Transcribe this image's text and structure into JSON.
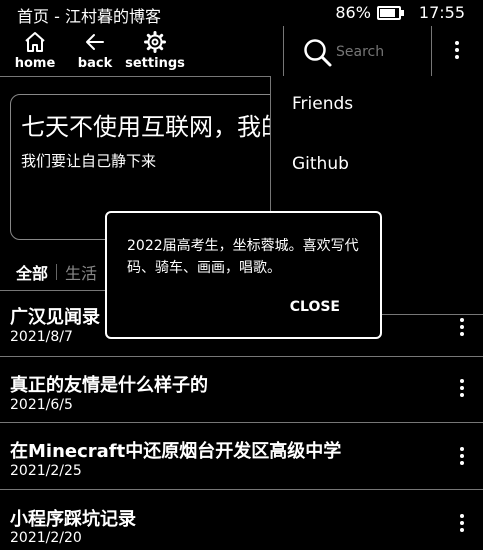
{
  "status_bar": {
    "title": "首页 - 江村暮的博客",
    "battery_percent": "86%",
    "battery_level": 0.86,
    "time": "17:55"
  },
  "toolbar": {
    "home_label": "home",
    "home_icon": "home-icon",
    "back_label": "back",
    "back_icon": "arrow-left-icon",
    "settings_label": "settings",
    "settings_icon": "gear-icon",
    "search_placeholder": "Search"
  },
  "banner": {
    "title": "七天不使用互联网，我的",
    "subtitle": "我们要让自己静下来"
  },
  "tabs": [
    "全部",
    "生活"
  ],
  "posts": [
    {
      "title": "广汉见闻录",
      "date": "2021/8/7"
    },
    {
      "title": "真正的友情是什么样子的",
      "date": "2021/6/5"
    },
    {
      "title": "在Minecraft中还原烟台开发区高级中学",
      "date": "2021/2/25"
    },
    {
      "title": "小程序踩坑记录",
      "date": "2021/2/20"
    }
  ],
  "dropdown_menu": {
    "items": [
      "Friends",
      "Github"
    ]
  },
  "dialog": {
    "text": "2022届高考生，坐标蓉城。喜欢写代码、骑车、画画，唱歌。",
    "close_label": "CLOSE"
  }
}
